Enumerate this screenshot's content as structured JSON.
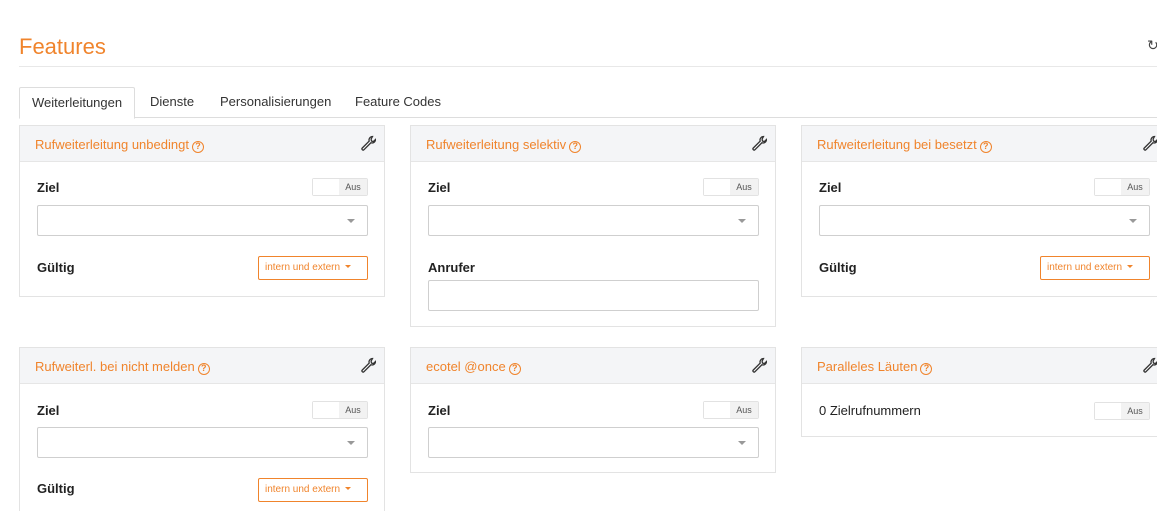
{
  "page": {
    "title": "Features"
  },
  "icons": {
    "refresh": "refresh-icon",
    "help": "help-icon",
    "wrench": "wrench-icon"
  },
  "colors": {
    "accent": "#f0842c",
    "header_bg": "#f4f5f7",
    "border": "#e3e3e3"
  },
  "tabs": [
    {
      "label": "Weiterleitungen",
      "active": true
    },
    {
      "label": "Dienste",
      "active": false
    },
    {
      "label": "Personalisierungen",
      "active": false
    },
    {
      "label": "Feature Codes",
      "active": false
    }
  ],
  "cards": {
    "unbedingt": {
      "title": "Rufweiterleitung unbedingt",
      "help": "?",
      "ziel_label": "Ziel",
      "toggle": "Aus",
      "ziel_value": "",
      "gueltig_label": "Gültig",
      "gueltig_value": "intern und extern"
    },
    "selektiv": {
      "title": "Rufweiterleitung selektiv",
      "help": "?",
      "ziel_label": "Ziel",
      "toggle": "Aus",
      "ziel_value": "",
      "anrufer_label": "Anrufer",
      "anrufer_value": ""
    },
    "besetzt": {
      "title": "Rufweiterleitung bei besetzt",
      "help": "?",
      "ziel_label": "Ziel",
      "toggle": "Aus",
      "ziel_value": "",
      "gueltig_label": "Gültig",
      "gueltig_value": "intern und extern"
    },
    "nicht_melden": {
      "title": "Rufweiterl. bei nicht melden",
      "help": "?",
      "ziel_label": "Ziel",
      "toggle": "Aus",
      "ziel_value": "",
      "gueltig_label": "Gültig",
      "gueltig_value": "intern und extern"
    },
    "ecotel": {
      "title": "ecotel @once",
      "help": "?",
      "ziel_label": "Ziel",
      "toggle": "Aus",
      "ziel_value": ""
    },
    "parallel": {
      "title": "Paralleles Läuten",
      "help": "?",
      "count_label": "0 Zielrufnummern",
      "toggle": "Aus"
    }
  }
}
